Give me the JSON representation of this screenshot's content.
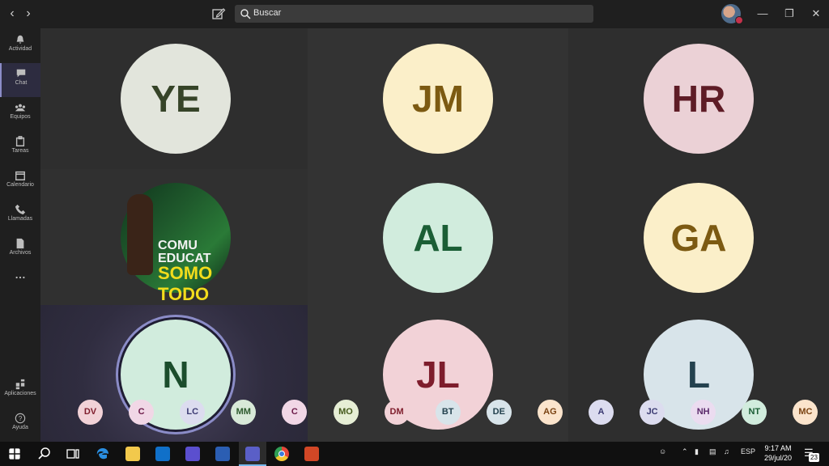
{
  "titlebar": {
    "back_icon": "chevron-left-icon",
    "forward_icon": "chevron-right-icon",
    "compose_icon": "compose-icon",
    "search_placeholder": "Buscar",
    "status_color": "#c4314b"
  },
  "sidebar": {
    "accent": "#8b8cc7",
    "items": [
      {
        "label": "Actividad",
        "icon": "bell-icon"
      },
      {
        "label": "Chat",
        "icon": "chat-icon",
        "active": true
      },
      {
        "label": "Equipos",
        "icon": "teams-icon"
      },
      {
        "label": "Tareas",
        "icon": "assignments-icon"
      },
      {
        "label": "Calendario",
        "icon": "calendar-icon"
      },
      {
        "label": "Llamadas",
        "icon": "phone-icon"
      },
      {
        "label": "Archivos",
        "icon": "files-icon"
      },
      {
        "label": "",
        "icon": "more-icon"
      }
    ],
    "bottom": [
      {
        "label": "Aplicaciones",
        "icon": "apps-icon"
      },
      {
        "label": "Ayuda",
        "icon": "help-icon"
      }
    ]
  },
  "grid": {
    "tiles": [
      {
        "initials": "YE",
        "bg": "#e2e5dc",
        "fg": "#364428"
      },
      {
        "initials": "JM",
        "bg": "#fbefc9",
        "fg": "#7c5a12"
      },
      {
        "initials": "HR",
        "bg": "#ebd1d6",
        "fg": "#5e1c26"
      },
      {
        "initials": "",
        "photo": true,
        "photo_text": [
          "COMU",
          "EDUCAT",
          "SOMO",
          "TODO"
        ]
      },
      {
        "initials": "AL",
        "bg": "#d1ecdd",
        "fg": "#1b5e35"
      },
      {
        "initials": "GA",
        "bg": "#fbefc9",
        "fg": "#7c5a12"
      },
      {
        "initials": "N",
        "bg": "#d1ecdd",
        "fg": "#1b4d2c",
        "speaking": true
      },
      {
        "initials": "JL",
        "bg": "#f2d2d7",
        "fg": "#7e1d2c"
      },
      {
        "initials": "L",
        "bg": "#d8e4ea",
        "fg": "#24424f"
      }
    ]
  },
  "overflow": [
    {
      "initials": "DV",
      "bg": "#f2d2d7",
      "fg": "#7e1d2c"
    },
    {
      "initials": "C",
      "bg": "#f1d7e6",
      "fg": "#6b1a48"
    },
    {
      "initials": "LC",
      "bg": "#dcdcef",
      "fg": "#3b3a72"
    },
    {
      "initials": "MM",
      "bg": "#d8e9d8",
      "fg": "#2d5a2d"
    },
    {
      "initials": "C",
      "bg": "#f1d7e6",
      "fg": "#6b1a48"
    },
    {
      "initials": "MO",
      "bg": "#e6eed5",
      "fg": "#455a1c"
    },
    {
      "initials": "DM",
      "bg": "#f2d2d7",
      "fg": "#7e1d2c"
    },
    {
      "initials": "BT",
      "bg": "#d8e4ea",
      "fg": "#24424f"
    },
    {
      "initials": "DE",
      "bg": "#d8e4ea",
      "fg": "#24424f"
    },
    {
      "initials": "AG",
      "bg": "#fbe4cc",
      "fg": "#7a4312"
    },
    {
      "initials": "A",
      "bg": "#dcdcef",
      "fg": "#3b3a72"
    },
    {
      "initials": "JC",
      "bg": "#dcdcef",
      "fg": "#3b3a72"
    },
    {
      "initials": "NH",
      "bg": "#ebdcf0",
      "fg": "#5b2a6b"
    },
    {
      "initials": "NT",
      "bg": "#d1ecdd",
      "fg": "#1b5e35"
    },
    {
      "initials": "MC",
      "bg": "#fbe4cc",
      "fg": "#7a4312"
    }
  ],
  "taskbar": {
    "apps": [
      "windows-start-icon",
      "search-icon",
      "task-view-icon",
      "edge-icon",
      "file-explorer-icon",
      "outlook-icon",
      "chat-app-icon",
      "word-icon",
      "teams-icon",
      "chrome-icon",
      "powerpoint-icon"
    ],
    "language": "ESP",
    "time": "9:17 AM",
    "date": "29/jul/20",
    "notifications": "23"
  }
}
